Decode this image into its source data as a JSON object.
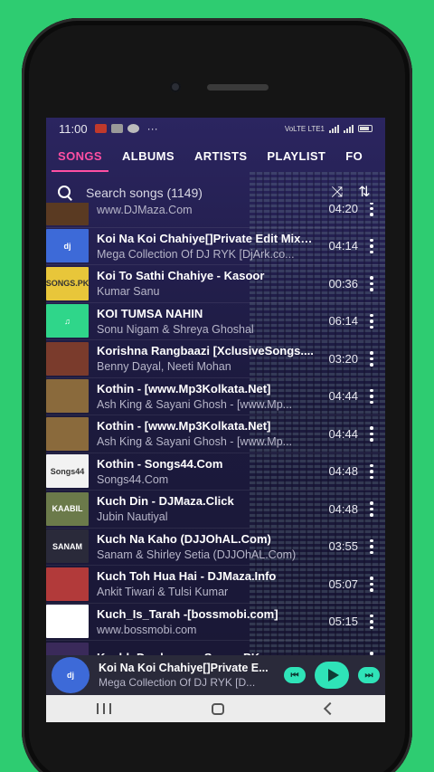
{
  "status_bar": {
    "time": "11:00",
    "more": "···",
    "network": "VoLTE LTE1"
  },
  "tabs": [
    "SONGS",
    "ALBUMS",
    "ARTISTS",
    "PLAYLIST",
    "FO"
  ],
  "search": {
    "placeholder": "Search songs (1149)"
  },
  "songs": [
    {
      "title": "",
      "artist": "www.DJMaza.Com",
      "duration": "04:20",
      "thumb_bg": "#5a3a22",
      "thumb_text": ""
    },
    {
      "title": "Koi Na Koi Chahiye[]Private Edit Mix(...",
      "artist": "Mega Collection Of DJ RYK [DjArk.co...",
      "duration": "04:14",
      "thumb_bg": "#3d6ad8",
      "thumb_text": "dj"
    },
    {
      "title": "Koi To Sathi Chahiye - Kasoor",
      "artist": "Kumar Sanu",
      "duration": "00:36",
      "thumb_bg": "#e8c63a",
      "thumb_text": "SONGS.PK"
    },
    {
      "title": "KOI TUMSA NAHIN",
      "artist": "Sonu Nigam & Shreya Ghoshal",
      "duration": "06:14",
      "thumb_bg": "#2fd68a",
      "thumb_text": "♫"
    },
    {
      "title": "Korishna Rangbaazi [XclusiveSongs....",
      "artist": "Benny Dayal, Neeti Mohan",
      "duration": "03:20",
      "thumb_bg": "#7a3b2c",
      "thumb_text": ""
    },
    {
      "title": "Kothin - [www.Mp3Kolkata.Net]",
      "artist": "Ash King & Sayani Ghosh - [www.Mp...",
      "duration": "04:44",
      "thumb_bg": "#8a6a3c",
      "thumb_text": ""
    },
    {
      "title": "Kothin - [www.Mp3Kolkata.Net]",
      "artist": "Ash King & Sayani Ghosh - [www.Mp...",
      "duration": "04:44",
      "thumb_bg": "#8a6a3c",
      "thumb_text": ""
    },
    {
      "title": "Kothin - Songs44.Com",
      "artist": "Songs44.Com",
      "duration": "04:48",
      "thumb_bg": "#f2f2f2",
      "thumb_text": "Songs44"
    },
    {
      "title": "Kuch Din - DJMaza.Click",
      "artist": "Jubin Nautiyal",
      "duration": "04:48",
      "thumb_bg": "#6b7a4a",
      "thumb_text": "KAABIL"
    },
    {
      "title": "Kuch Na Kaho (DJJOhAL.Com)",
      "artist": "Sanam & Shirley Setia (DJJOhAL.Com)",
      "duration": "03:55",
      "thumb_bg": "#2a2a3a",
      "thumb_text": "SANAM"
    },
    {
      "title": "Kuch Toh Hua Hai - DJMaza.Info",
      "artist": "Ankit Tiwari & Tulsi Kumar",
      "duration": "05:07",
      "thumb_bg": "#b23a3a",
      "thumb_text": ""
    },
    {
      "title": "Kuch_Is_Tarah -[bossmobi.com]",
      "artist": "www.bossmobi.com",
      "duration": "05:15",
      "thumb_bg": "#ffffff",
      "thumb_text": ""
    },
    {
      "title": "Kuchh Dard - www.Songs.PK",
      "artist": "",
      "duration": "",
      "thumb_bg": "#3a2a5a",
      "thumb_text": ""
    }
  ],
  "now_playing": {
    "title": "Koi Na Koi Chahiye[]Private E...",
    "artist": "Mega Collection Of DJ RYK [D..."
  },
  "colors": {
    "accent": "#ff4fa3",
    "player_button": "#2fe3b8",
    "background": "#2ecc71"
  }
}
